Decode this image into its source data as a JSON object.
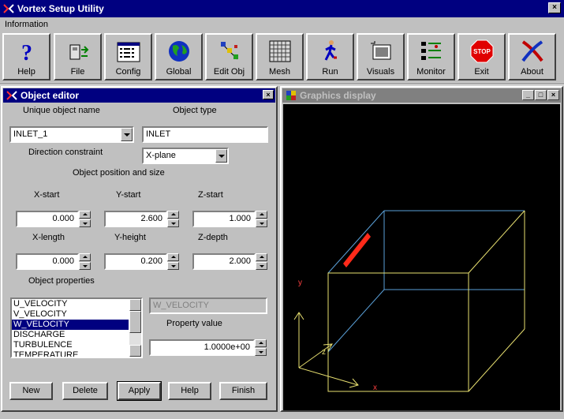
{
  "window": {
    "title": "Vortex Setup Utility",
    "close_glyph": "×"
  },
  "menu": [
    "Information"
  ],
  "toolbar": [
    {
      "label": "Help",
      "icon": "help-icon"
    },
    {
      "label": "File",
      "icon": "file-icon"
    },
    {
      "label": "Config",
      "icon": "config-icon"
    },
    {
      "label": "Global",
      "icon": "globe-icon"
    },
    {
      "label": "Edit Obj",
      "icon": "edit-object-icon"
    },
    {
      "label": "Mesh",
      "icon": "mesh-icon"
    },
    {
      "label": "Run",
      "icon": "run-icon"
    },
    {
      "label": "Visuals",
      "icon": "visuals-icon"
    },
    {
      "label": "Monitor",
      "icon": "monitor-icon"
    },
    {
      "label": "Exit",
      "icon": "stop-sign-icon",
      "stop_text": "STOP"
    },
    {
      "label": "About",
      "icon": "about-icon"
    }
  ],
  "editor": {
    "title": "Object editor",
    "name_label": "Unique object name",
    "type_label": "Object type",
    "name_value": "INLET_1",
    "type_value": "INLET",
    "direction_label": "Direction constraint",
    "direction_value": "X-plane",
    "position_label": "Object position and size",
    "xstart_label": "X-start",
    "ystart_label": "Y-start",
    "zstart_label": "Z-start",
    "xstart": "0.000",
    "ystart": "2.600",
    "zstart": "1.000",
    "xlen_label": "X-length",
    "yheight_label": "Y-height",
    "zdepth_label": "Z-depth",
    "xlen": "0.000",
    "yheight": "0.200",
    "zdepth": "2.000",
    "props_label": "Object properties",
    "properties": [
      "U_VELOCITY",
      "V_VELOCITY",
      "W_VELOCITY",
      "DISCHARGE",
      "TURBULENCE",
      "TEMPERATURE"
    ],
    "selected_property": "W_VELOCITY",
    "prop_value_label": "Property value",
    "prop_value": "1.0000e+00",
    "buttons": {
      "new": "New",
      "delete": "Delete",
      "apply": "Apply",
      "help": "Help",
      "finish": "Finish"
    }
  },
  "graphics": {
    "title": "Graphics display",
    "axis_x": "x",
    "axis_y": "y",
    "axis_z": "z",
    "colors": {
      "box": "#e8e070",
      "hidden_edges": "#5aa0d8",
      "inlet": "#ff2a1a",
      "axes": "#e8e070",
      "axis_labels": "#ff4040"
    }
  }
}
